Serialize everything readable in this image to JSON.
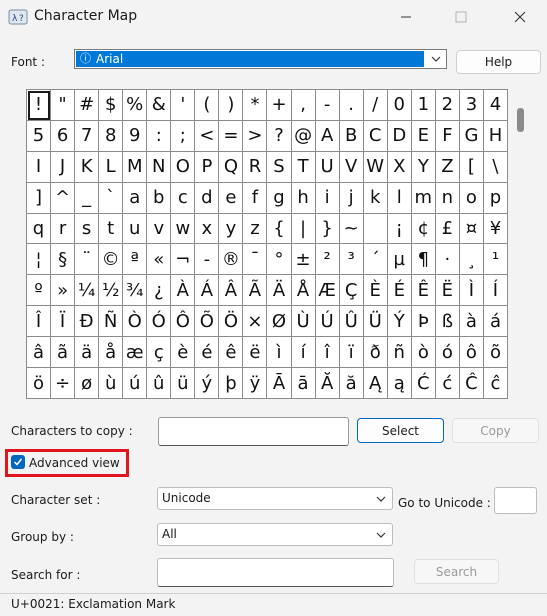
{
  "window": {
    "title": "Character Map"
  },
  "font": {
    "label": "Font :",
    "value": "Arial",
    "help_label": "Help"
  },
  "grid": {
    "rows": [
      [
        "!",
        "\"",
        "#",
        "$",
        "%",
        "&",
        "'",
        "(",
        ")",
        "*",
        "+",
        ",",
        "-",
        ".",
        "/",
        "0",
        "1",
        "2",
        "3",
        "4"
      ],
      [
        "5",
        "6",
        "7",
        "8",
        "9",
        ":",
        ";",
        "<",
        "=",
        ">",
        "?",
        "@",
        "A",
        "B",
        "C",
        "D",
        "E",
        "F",
        "G",
        "H"
      ],
      [
        "I",
        "J",
        "K",
        "L",
        "M",
        "N",
        "O",
        "P",
        "Q",
        "R",
        "S",
        "T",
        "U",
        "V",
        "W",
        "X",
        "Y",
        "Z",
        "[",
        "\\"
      ],
      [
        "]",
        "^",
        "_",
        "`",
        "a",
        "b",
        "c",
        "d",
        "e",
        "f",
        "g",
        "h",
        "i",
        "j",
        "k",
        "l",
        "m",
        "n",
        "o",
        "p"
      ],
      [
        "q",
        "r",
        "s",
        "t",
        "u",
        "v",
        "w",
        "x",
        "y",
        "z",
        "{",
        "|",
        "}",
        "~",
        " ",
        "¡",
        "¢",
        "£",
        "¤",
        "¥"
      ],
      [
        "¦",
        "§",
        "¨",
        "©",
        "ª",
        "«",
        "¬",
        "-",
        "®",
        "¯",
        "°",
        "±",
        "²",
        "³",
        "´",
        "µ",
        "¶",
        "·",
        "¸",
        "¹"
      ],
      [
        "º",
        "»",
        "¼",
        "½",
        "¾",
        "¿",
        "À",
        "Á",
        "Â",
        "Ã",
        "Ä",
        "Å",
        "Æ",
        "Ç",
        "È",
        "É",
        "Ê",
        "Ë",
        "Ì",
        "Í"
      ],
      [
        "Î",
        "Ï",
        "Đ",
        "Ñ",
        "Ò",
        "Ó",
        "Ô",
        "Õ",
        "Ö",
        "×",
        "Ø",
        "Ù",
        "Ú",
        "Û",
        "Ü",
        "Ý",
        "Þ",
        "ß",
        "à",
        "á"
      ],
      [
        "â",
        "ã",
        "ä",
        "å",
        "æ",
        "ç",
        "è",
        "é",
        "ê",
        "ë",
        "ì",
        "í",
        "î",
        "ï",
        "ð",
        "ñ",
        "ò",
        "ó",
        "ô",
        "õ"
      ],
      [
        "ö",
        "÷",
        "ø",
        "ù",
        "ú",
        "û",
        "ü",
        "ý",
        "þ",
        "ÿ",
        "Ā",
        "ā",
        "Ă",
        "ă",
        "Ą",
        "ą",
        "Ć",
        "ć",
        "Ĉ",
        "ĉ"
      ]
    ],
    "selected": "!"
  },
  "copy": {
    "label": "Characters to copy :",
    "value": "",
    "select_label": "Select",
    "copy_label": "Copy"
  },
  "advanced": {
    "label": "Advanced view",
    "checked": true
  },
  "charset": {
    "label": "Character set :",
    "value": "Unicode",
    "goto_label": "Go to Unicode :",
    "goto_value": ""
  },
  "groupby": {
    "label": "Group by :",
    "value": "All"
  },
  "search": {
    "label": "Search for :",
    "value": "",
    "button_label": "Search"
  },
  "status": {
    "text": "U+0021: Exclamation Mark"
  },
  "colors": {
    "accent": "#0067c0",
    "highlight": "#e0151f",
    "selection": "#0078d7"
  }
}
